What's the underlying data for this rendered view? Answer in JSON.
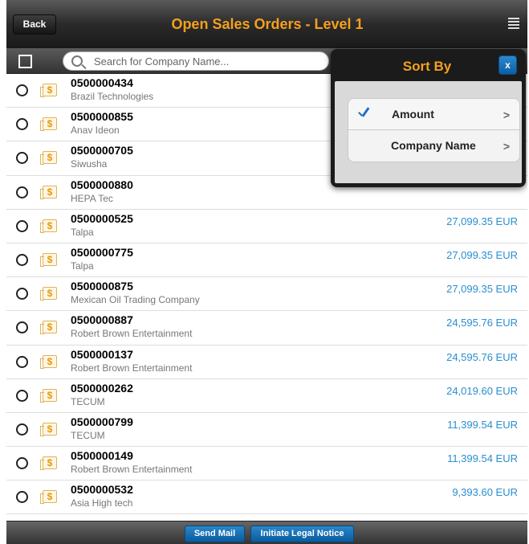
{
  "header": {
    "back_label": "Back",
    "title": "Open Sales Orders - Level 1",
    "menu_icon": "list-icon"
  },
  "search": {
    "placeholder": "Search for Company Name..."
  },
  "orders": [
    {
      "order_no": "0500000434",
      "company": "Brazil Technologies",
      "amount": ""
    },
    {
      "order_no": "0500000855",
      "company": "Anav Ideon",
      "amount": ""
    },
    {
      "order_no": "0500000705",
      "company": "Siwusha",
      "amount": ""
    },
    {
      "order_no": "0500000880",
      "company": "HEPA Tec",
      "amount": ""
    },
    {
      "order_no": "0500000525",
      "company": "Talpa",
      "amount": "27,099.35 EUR"
    },
    {
      "order_no": "0500000775",
      "company": "Talpa",
      "amount": "27,099.35 EUR"
    },
    {
      "order_no": "0500000875",
      "company": "Mexican Oil Trading Company",
      "amount": "27,099.35 EUR"
    },
    {
      "order_no": "0500000887",
      "company": "Robert Brown Entertainment",
      "amount": "24,595.76 EUR"
    },
    {
      "order_no": "0500000137",
      "company": "Robert Brown Entertainment",
      "amount": "24,595.76 EUR"
    },
    {
      "order_no": "0500000262",
      "company": "TECUM",
      "amount": "24,019.60 EUR"
    },
    {
      "order_no": "0500000799",
      "company": "TECUM",
      "amount": "11,399.54 EUR"
    },
    {
      "order_no": "0500000149",
      "company": "Robert Brown Entertainment",
      "amount": "11,399.54 EUR"
    },
    {
      "order_no": "0500000532",
      "company": "Asia High tech",
      "amount": "9,393.60 EUR"
    }
  ],
  "footer": {
    "send_mail_label": "Send Mail",
    "legal_notice_label": "Initiate Legal Notice"
  },
  "sort_popover": {
    "title": "Sort By",
    "close_label": "x",
    "options": [
      {
        "label": "Amount",
        "selected": true
      },
      {
        "label": "Company Name",
        "selected": false
      }
    ],
    "chevron": ">"
  },
  "colors": {
    "title": "#f5a01e",
    "amount": "#2b8ecf",
    "button_blue": "#1a74b8"
  }
}
